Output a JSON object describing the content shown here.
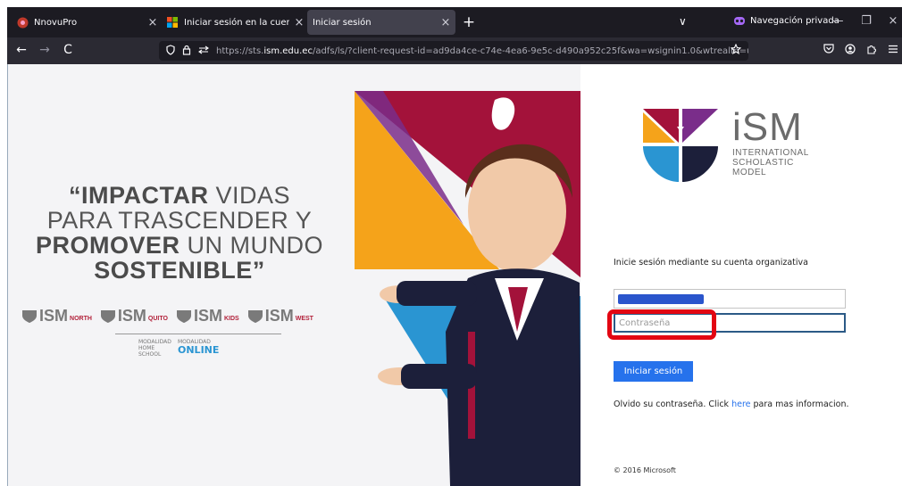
{
  "browser": {
    "tabs": [
      {
        "label": "NnovuPro",
        "close": "×"
      },
      {
        "label": "Iniciar sesión en la cuenta",
        "close": "×"
      },
      {
        "label": "Iniciar sesión",
        "close": "×"
      }
    ],
    "new_tab": "+",
    "list_tabs": "∨",
    "private_label": "Navegación privada",
    "window": {
      "minimize": "—",
      "restore": "❐",
      "close": "×"
    },
    "nav": {
      "back": "←",
      "forward": "→",
      "reload": "C"
    },
    "url_prefix": "https://sts.",
    "url_domain": "ism.edu.ec",
    "url_rest": "/adfs/ls/?client-request-id=ad9da4ce-c74e-4ea6-9e5c-d490a952c25f&wa=wsignin1.0&wtrealm=urn%",
    "icons": [
      "shield-icon",
      "lock-icon",
      "permissions-icon",
      "star-icon",
      "pocket-icon",
      "account-icon",
      "extensions-icon",
      "menu-icon"
    ]
  },
  "banner": {
    "slogan_quote_open": "“",
    "slogan_w1": "IMPACTAR",
    "slogan_t1": " VIDAS",
    "slogan_l2": "PARA TRASCENDER Y",
    "slogan_w3": "PROMOVER",
    "slogan_t3": " UN MUNDO",
    "slogan_w4": "SOSTENIBLE",
    "slogan_quote_close": "”",
    "brands": [
      {
        "name": "ISM",
        "suffix": "NORTH"
      },
      {
        "name": "ISM",
        "suffix": "QUITO"
      },
      {
        "name": "ISM",
        "suffix": "KIDS"
      },
      {
        "name": "ISM",
        "suffix": "WEST"
      }
    ],
    "modal1_a": "MODALIDAD",
    "modal1_b": "HOME",
    "modal1_c": "SCHOOL",
    "modal2_a": "MODALIDAD",
    "modal2_b": "ONLINE"
  },
  "logo": {
    "name": "iSM",
    "line1": "INTERNATIONAL",
    "line2": "SCHOLASTIC",
    "line3": "MODEL"
  },
  "form": {
    "prompt": "Inicie sesión mediante su cuenta organizativa",
    "password_placeholder": "Contraseña",
    "signin_label": "Iniciar sesión",
    "forgot_pre": "Olvido su contraseña. Click ",
    "forgot_link": "here",
    "forgot_post": " para mas informacion.",
    "copyright": "© 2016 Microsoft"
  },
  "colors": {
    "accent": "#2672ec",
    "highlight": "#e30612",
    "crimson": "#a3123a",
    "orange": "#f5a31a",
    "purple": "#7a2d8a",
    "blue": "#2a95d2"
  }
}
